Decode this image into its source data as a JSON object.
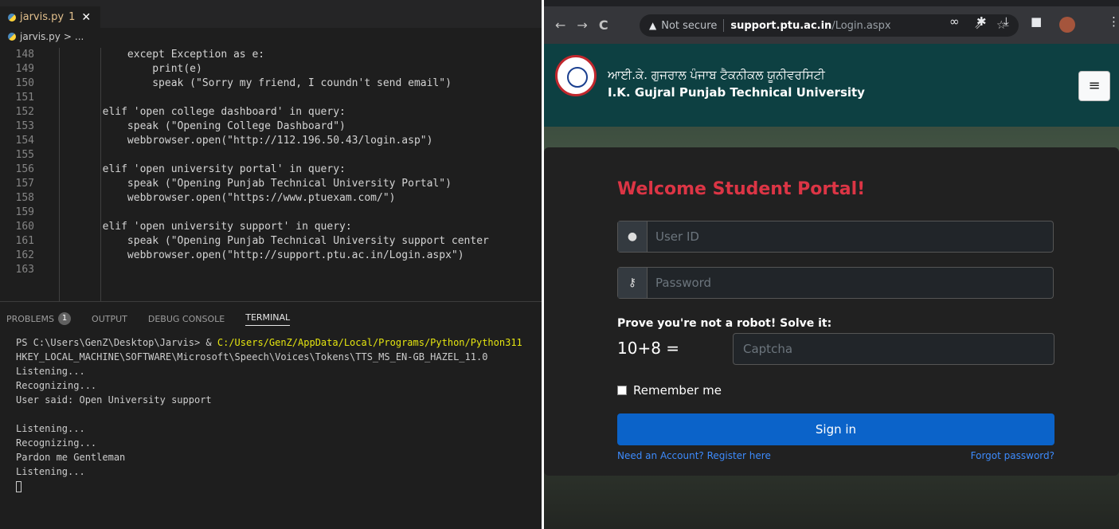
{
  "vscode": {
    "tab": {
      "filename": "jarvis.py",
      "problem_count": "1",
      "close": "✕"
    },
    "breadcrumb": {
      "file": "jarvis.py",
      "sep": ">",
      "rest": "..."
    },
    "code_lines": [
      {
        "num": "148",
        "text": "            except Exception as e:"
      },
      {
        "num": "149",
        "text": "                print(e)"
      },
      {
        "num": "150",
        "text": "                speak (\"Sorry my friend, I coundn't send email\")"
      },
      {
        "num": "151",
        "text": ""
      },
      {
        "num": "152",
        "text": "        elif 'open college dashboard' in query:"
      },
      {
        "num": "153",
        "text": "            speak (\"Opening College Dashboard\")"
      },
      {
        "num": "154",
        "text": "            webbrowser.open(\"http://112.196.50.43/login.asp\")"
      },
      {
        "num": "155",
        "text": ""
      },
      {
        "num": "156",
        "text": "        elif 'open university portal' in query:"
      },
      {
        "num": "157",
        "text": "            speak (\"Opening Punjab Technical University Portal\")"
      },
      {
        "num": "158",
        "text": "            webbrowser.open(\"https://www.ptuexam.com/\")"
      },
      {
        "num": "159",
        "text": ""
      },
      {
        "num": "160",
        "text": "        elif 'open university support' in query:"
      },
      {
        "num": "161",
        "text": "            speak (\"Opening Punjab Technical University support center"
      },
      {
        "num": "162",
        "text": "            webbrowser.open(\"http://support.ptu.ac.in/Login.aspx\")"
      },
      {
        "num": "163",
        "text": ""
      }
    ],
    "panel": {
      "tabs": [
        "PROBLEMS",
        "OUTPUT",
        "DEBUG CONSOLE",
        "TERMINAL"
      ],
      "problems_badge": "1",
      "terminal_prompt": "PS C:\\Users\\GenZ\\Desktop\\Jarvis> & ",
      "terminal_path": "C:/Users/GenZ/AppData/Local/Programs/Python/Python311",
      "terminal_lines": [
        "HKEY_LOCAL_MACHINE\\SOFTWARE\\Microsoft\\Speech\\Voices\\Tokens\\TTS_MS_EN-GB_HAZEL_11.0",
        "Listening...",
        "Recognizing...",
        "User said: Open University support",
        "",
        "Listening...",
        "Recognizing...",
        "Pardon me Gentleman",
        "Listening..."
      ]
    }
  },
  "browser": {
    "nav": {
      "back": "←",
      "forward": "→",
      "reload": "C"
    },
    "address": {
      "warning_icon": "▲",
      "not_secure": "Not secure",
      "host": "support.ptu.ac.in",
      "path": "/Login.aspx",
      "share": "⇗",
      "star": "☆"
    },
    "toolbar_icons": {
      "extension": "∞",
      "puzzle": "✱",
      "download": "⤓",
      "sidebar": "■",
      "menu": "⋮"
    },
    "site": {
      "name_punjabi": "ਆਈ.ਕੇ. ਗੁਜਰਾਲ ਪੰਜਾਬ ਟੈਕਨੀਕਲ ਯੂਨੀਵਰਸਿਟੀ",
      "name_english": "I.K. Gujral Punjab Technical University",
      "menu_icon": "≡"
    },
    "login": {
      "title": "Welcome Student Portal!",
      "user_icon": "●",
      "key_icon": "⚷",
      "userid_placeholder": "User ID",
      "password_placeholder": "Password",
      "robot_label": "Prove you're not a robot! Solve it:",
      "captcha_question": "10+8 =",
      "captcha_placeholder": "Captcha",
      "remember_label": "Remember me",
      "signin_label": "Sign in",
      "register_link": "Need an Account? Register here",
      "forgot_link": "Forgot password?"
    }
  },
  "colors": {
    "accent_red": "#dc3545",
    "button_blue": "#0b63c9",
    "link_blue": "#3d8bfd",
    "header_teal": "#0d4042"
  }
}
